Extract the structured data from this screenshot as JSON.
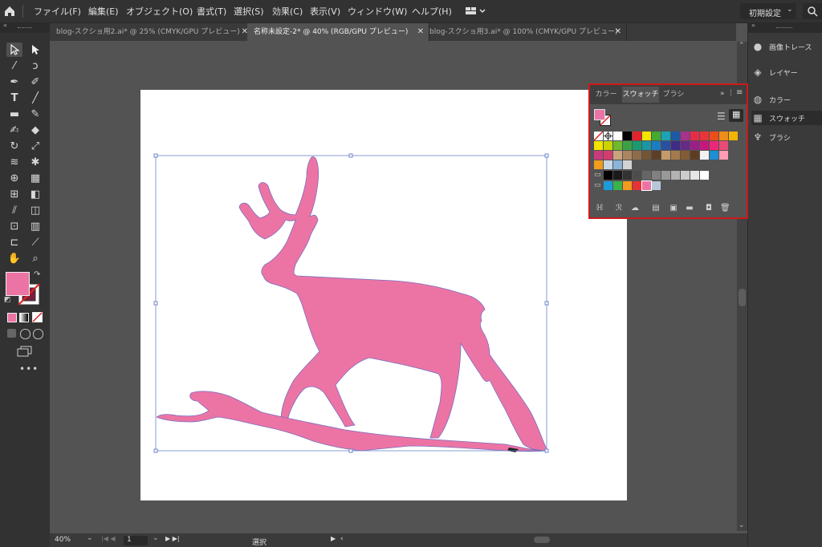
{
  "menubar": {
    "items": [
      "ファイル(F)",
      "編集(E)",
      "オブジェクト(O)",
      "書式(T)",
      "選択(S)",
      "効果(C)",
      "表示(V)",
      "ウィンドウ(W)",
      "ヘルプ(H)"
    ],
    "workspace": "初期設定"
  },
  "tabs": [
    {
      "label": "blog-スクショ用2.ai* @ 25% (CMYK/GPU プレビュー)",
      "active": false
    },
    {
      "label": "名称未設定-2* @ 40% (RGB/GPU プレビュー)",
      "active": true
    },
    {
      "label": "blog-スクショ用3.ai* @ 100% (CMYK/GPU プレビュー)",
      "active": false
    }
  ],
  "tab_close": "✕",
  "dock": {
    "items": [
      {
        "label": "画像トレース",
        "icon": "image-trace-icon"
      },
      {
        "label": "レイヤー",
        "icon": "layers-icon"
      },
      {
        "label": "カラー",
        "icon": "color-palette-icon"
      },
      {
        "label": "スウォッチ",
        "icon": "swatches-icon",
        "active": true
      },
      {
        "label": "ブラシ",
        "icon": "brush-icon"
      }
    ]
  },
  "swatch_panel": {
    "tabs": [
      "カラー",
      "スウォッチ",
      "ブラシ"
    ],
    "active_tab": "スウォッチ",
    "fill_color": "#ec74a5",
    "row1": [
      "none",
      "reg",
      "#ffffff",
      "#000000",
      "#e5232b",
      "#f2e500",
      "#44a935",
      "#1da4b4",
      "#1e59a6",
      "#a8328c",
      "#e72c4a",
      "#e8343a",
      "#e94e1b",
      "#f08c19",
      "#f4b400"
    ],
    "row2": [
      "#f4e500",
      "#c9d400",
      "#6fb92c",
      "#3aa245",
      "#1a9a6e",
      "#1995a3",
      "#1d7bbf",
      "#2a4f9c",
      "#3f2c87",
      "#652b86",
      "#9b1f87",
      "#c6177e",
      "#e9297a",
      "#e84b75"
    ],
    "row3": [
      "#c93a7c",
      "#d13d6e",
      "#c7a37e",
      "#ab8660",
      "#8e6c4a",
      "#745437",
      "#5b3f26",
      "#c59a6b",
      "#a57a4c",
      "#835b35",
      "#5d3d22",
      "#f2f2f2",
      "#1b8fd2",
      "#ff9bb4"
    ],
    "row4": [
      "#f29b1d",
      "#c9d6e6",
      "#8ab4d8",
      "#d3d3d3"
    ],
    "gray_row": [
      "#000000",
      "#1a1a1a",
      "#333333",
      "#4d4d4d",
      "#666666",
      "#808080",
      "#999999",
      "#b3b3b3",
      "#cccccc",
      "#e6e6e6",
      "#ffffff"
    ],
    "color_row": [
      "#1d9bd8",
      "#3ab44a",
      "#f39a1d",
      "#e73233",
      "#ec74a5",
      "#b6c8d8"
    ]
  },
  "status": {
    "zoom": "40%",
    "page": "1",
    "tool": "選択"
  },
  "artwork": {
    "fill": "#ec74a5",
    "stroke": "#7a6ebd",
    "label": "deer silhouette"
  }
}
